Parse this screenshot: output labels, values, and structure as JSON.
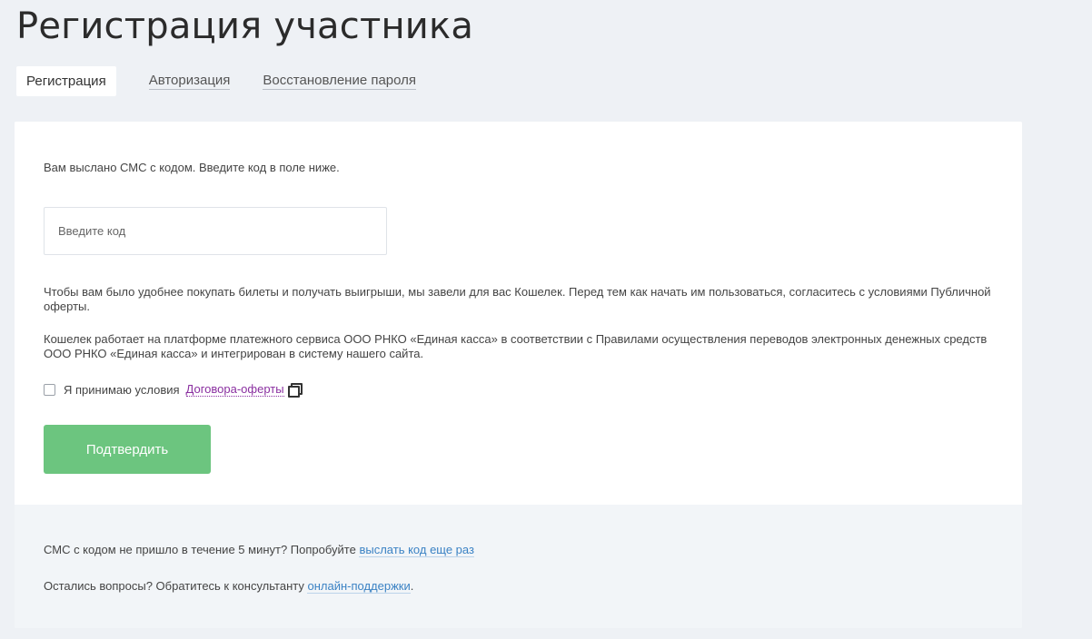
{
  "page": {
    "title": "Регистрация участника"
  },
  "tabs": [
    {
      "label": "Регистрация",
      "active": true
    },
    {
      "label": "Авторизация",
      "active": false
    },
    {
      "label": "Восстановление пароля",
      "active": false
    }
  ],
  "form": {
    "sms_sent_text": "Вам выслано СМС с кодом. Введите код в поле ниже.",
    "code_placeholder": "Введите код",
    "code_value": "",
    "wallet_info": "Чтобы вам было удобнее покупать билеты и получать выигрыши, мы завели для вас Кошелек. Перед тем как начать им пользоваться, согласитесь с условиями Публичной оферты.",
    "platform_info": "Кошелек работает на платформе платежного сервиса ООО РНКО «Единая касса» в соответствии с Правилами осуществления переводов электронных денежных средств ООО РНКО «Единая касса» и интегрирован в систему нашего сайта.",
    "agree_label": "Я принимаю условия",
    "agree_checked": false,
    "offer_link": "Договора-оферты",
    "confirm_button": "Подтвердить"
  },
  "footer": {
    "resend_prefix": "СМС с кодом не пришло в течение 5 минут? Попробуйте",
    "resend_link": "выслать код еще раз",
    "questions_prefix": "Остались вопросы? Обратитесь к консультанту",
    "support_link": "онлайн-поддержки",
    "questions_suffix": "."
  },
  "colors": {
    "background": "#eef1f5",
    "card": "#ffffff",
    "footer_bg": "#f2f5f8",
    "button": "#6cc57f",
    "offer_link": "#8a2fa0",
    "link": "#3b82c4"
  },
  "icons": {
    "offer_external": "copy-icon"
  }
}
